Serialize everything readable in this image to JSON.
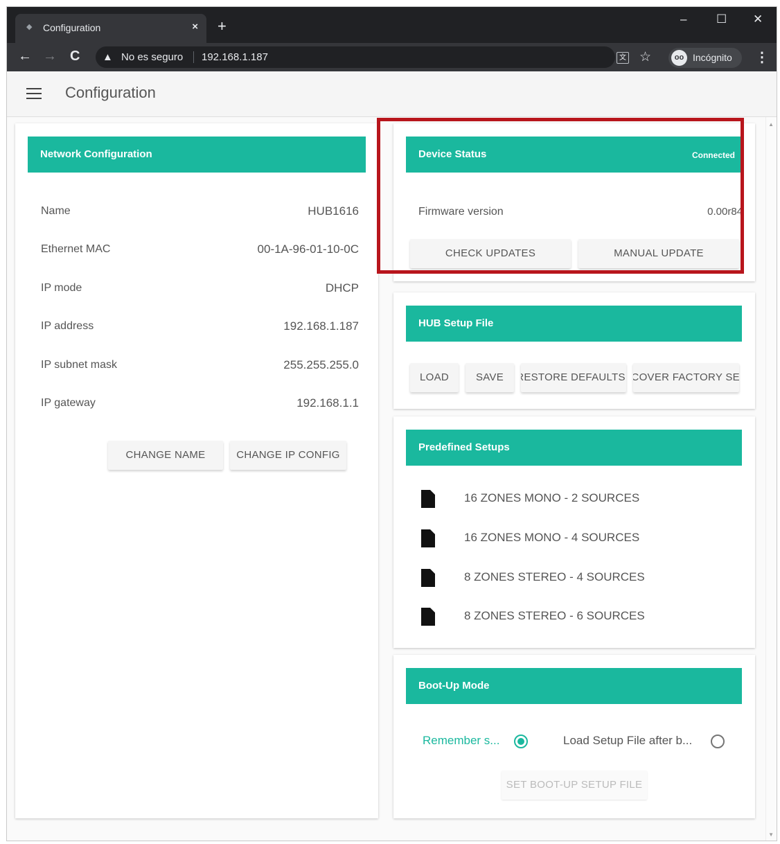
{
  "browser": {
    "tab_title": "Configuration",
    "close_glyph": "×",
    "new_tab_glyph": "+",
    "minimize_glyph": "–",
    "maximize_glyph": "☐",
    "window_close_glyph": "✕",
    "back_glyph": "←",
    "forward_glyph": "→",
    "reload_glyph": "C",
    "warning_glyph": "▲",
    "security_text": "No es seguro",
    "url": "192.168.1.187",
    "star_glyph": "☆",
    "incognito_label": "Incógnito",
    "menu_glyph": "⋮"
  },
  "app": {
    "title": "Configuration"
  },
  "network": {
    "title": "Network Configuration",
    "rows": [
      {
        "label": "Name",
        "value": "HUB1616"
      },
      {
        "label": "Ethernet MAC",
        "value": "00-1A-96-01-10-0C"
      },
      {
        "label": "IP mode",
        "value": "DHCP"
      },
      {
        "label": "IP address",
        "value": "192.168.1.187"
      },
      {
        "label": "IP subnet mask",
        "value": "255.255.255.0"
      },
      {
        "label": "IP gateway",
        "value": "192.168.1.1"
      }
    ],
    "change_name_label": "CHANGE NAME",
    "change_ip_label": "CHANGE IP CONFIG"
  },
  "device_status": {
    "title": "Device Status",
    "status": "Connected",
    "firmware_label": "Firmware version",
    "firmware_value": "0.00r84",
    "check_updates_label": "CHECK UPDATES",
    "manual_update_label": "MANUAL UPDATE"
  },
  "hub_setup": {
    "title": "HUB Setup File",
    "load_label": "LOAD",
    "save_label": "SAVE",
    "restore_label": "RESTORE DEFAULTS",
    "recover_label": "RECOVER FACTORY SETUP"
  },
  "predefined": {
    "title": "Predefined Setups",
    "items": [
      "16 ZONES MONO - 2 SOURCES",
      "16 ZONES MONO - 4 SOURCES",
      "8 ZONES STEREO - 4 SOURCES",
      "8 ZONES STEREO - 6 SOURCES"
    ]
  },
  "bootup": {
    "title": "Boot-Up Mode",
    "remember_label": "Remember s...",
    "load_after_label": "Load Setup File after b...",
    "set_file_label": "SET BOOT-UP SETUP FILE",
    "selected": "remember"
  },
  "colors": {
    "accent": "#1ab89e",
    "highlight": "#b8151c",
    "browser_dark": "#202124"
  }
}
